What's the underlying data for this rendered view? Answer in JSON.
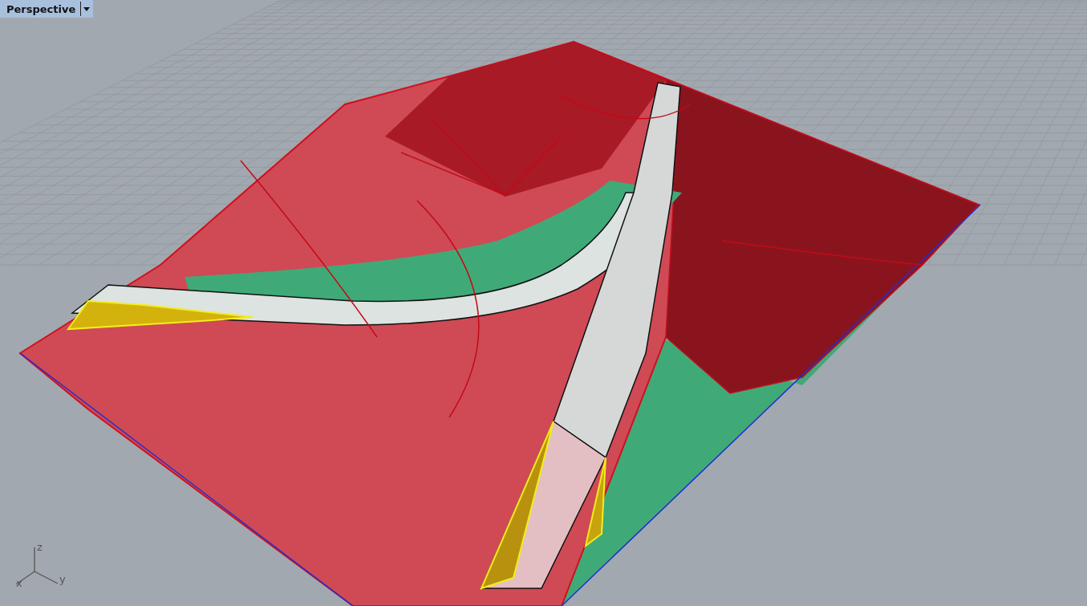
{
  "viewport": {
    "title": "Perspective"
  },
  "axis_labels": [
    "z",
    "x",
    "y"
  ]
}
